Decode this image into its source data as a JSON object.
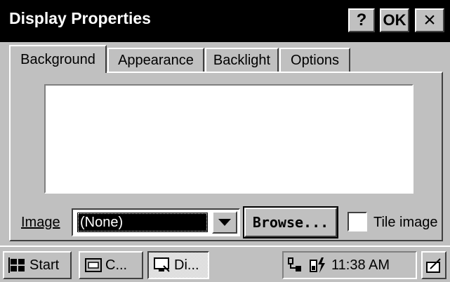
{
  "window": {
    "title": "Display Properties",
    "help_label": "?",
    "ok_label": "OK",
    "close_label": "×"
  },
  "tabs": [
    {
      "label": "Background",
      "active": true
    },
    {
      "label": "Appearance",
      "active": false
    },
    {
      "label": "Backlight",
      "active": false
    },
    {
      "label": "Options",
      "active": false
    }
  ],
  "background_tab": {
    "image_label": "Image",
    "image_value": "(None)",
    "browse_label": "Browse...",
    "tile_label": "Tile image",
    "tile_checked": false
  },
  "taskbar": {
    "start_label": "Start",
    "tasks": [
      {
        "label": "C..."
      },
      {
        "label": "Di..."
      }
    ],
    "clock": "11:38 AM"
  },
  "icons": {
    "start": "windows-flag-icon",
    "task_c": "control-panel-icon",
    "task_di": "display-icon",
    "tray_network": "network-icon",
    "tray_battery": "battery-power-icon",
    "keyboard": "input-panel-icon"
  }
}
